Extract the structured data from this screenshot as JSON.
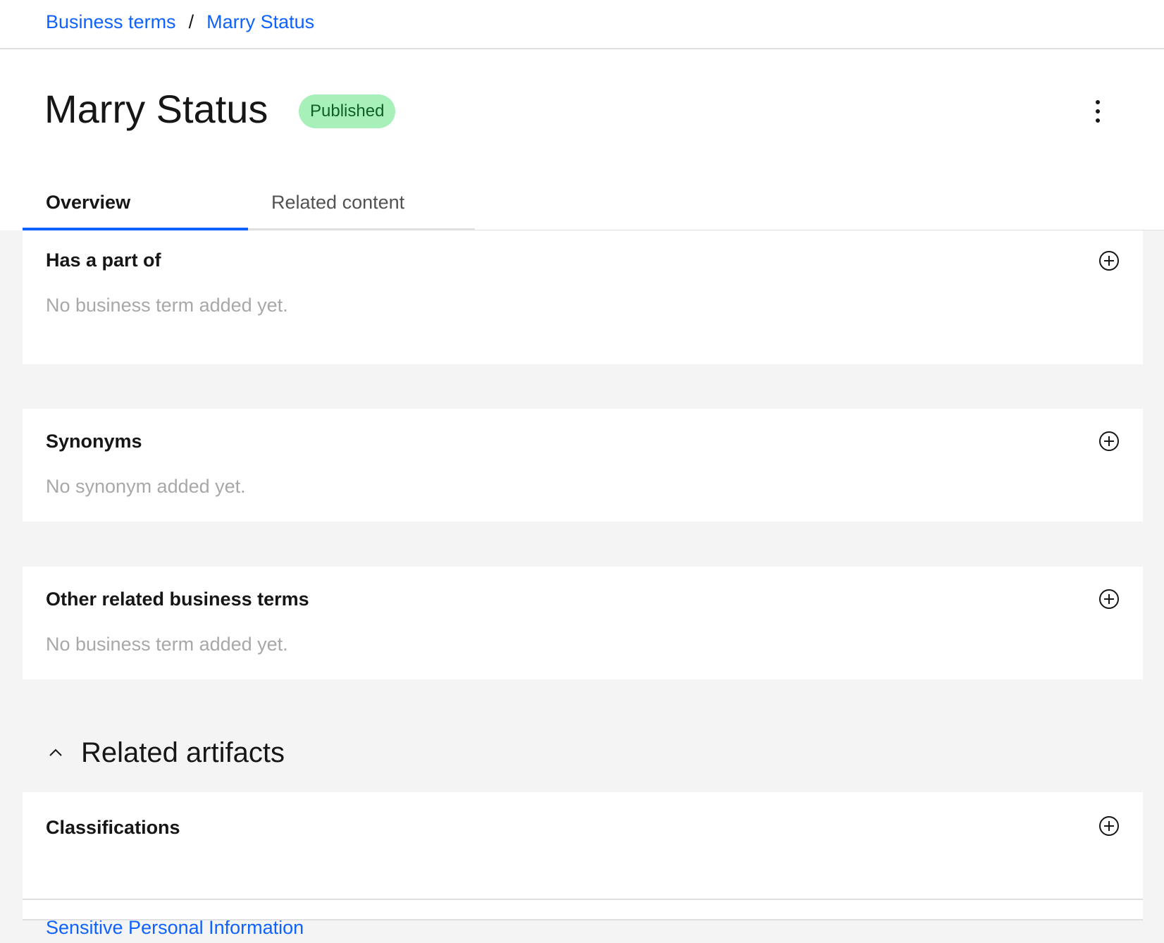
{
  "breadcrumb": {
    "items": [
      "Business terms",
      "Marry Status"
    ],
    "separator": "/"
  },
  "header": {
    "title": "Marry Status",
    "status": "Published",
    "overflow_icon": "overflow-menu-vertical-icon"
  },
  "tabs": [
    {
      "label": "Overview",
      "selected": true
    },
    {
      "label": "Related content",
      "selected": false
    }
  ],
  "sections": {
    "has_part_of": {
      "title": "Has a part of",
      "empty_text": "No business term added yet."
    },
    "synonyms": {
      "title": "Synonyms",
      "empty_text": "No synonym added yet."
    },
    "other_related": {
      "title": "Other related business terms",
      "empty_text": "No business term added yet."
    }
  },
  "related_artifacts": {
    "heading": "Related artifacts",
    "expanded": true,
    "classifications": {
      "title": "Classifications",
      "items": [
        "Sensitive Personal Information"
      ]
    }
  },
  "colors": {
    "link": "#0f62fe",
    "badge_bg": "#a7f0ba",
    "badge_text": "#0e6027",
    "page_bg": "#f4f4f4"
  }
}
